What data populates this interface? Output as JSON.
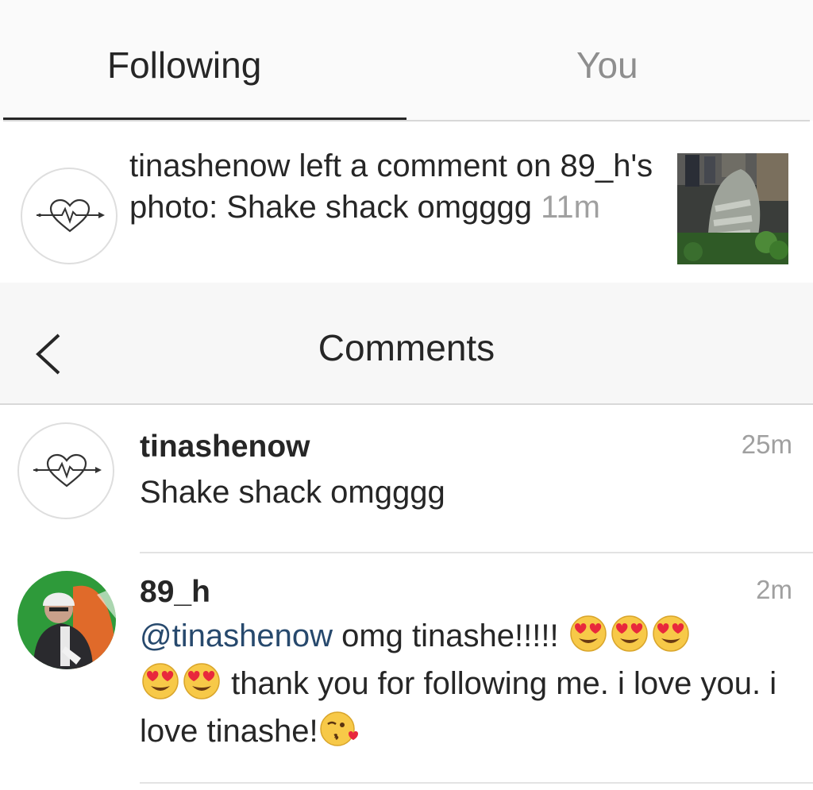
{
  "tabs": {
    "following": "Following",
    "you": "You"
  },
  "notification": {
    "username": "tinashenow",
    "text": " left a comment on 89_h's photo: Shake shack omgggg ",
    "time": "11m"
  },
  "header": {
    "title": "Comments",
    "back_icon": "chevron-left-icon"
  },
  "comments": [
    {
      "username": "tinashenow",
      "time": "25m",
      "text": "Shake shack omgggg"
    },
    {
      "username": "89_h",
      "time": "2m",
      "mention": "@tinashenow",
      "text_part1": " omg tinashe!!!!! ",
      "text_part2": " thank you for following me. i love you. i love tinashe!",
      "emojis": [
        "heart-eyes-emoji",
        "heart-eyes-emoji",
        "heart-eyes-emoji",
        "heart-eyes-emoji",
        "heart-eyes-emoji",
        "kissing-heart-emoji"
      ]
    }
  ],
  "colors": {
    "text": "#262626",
    "muted": "#a0a0a0",
    "mention": "#27496d",
    "tab_bg": "#fafafa"
  }
}
